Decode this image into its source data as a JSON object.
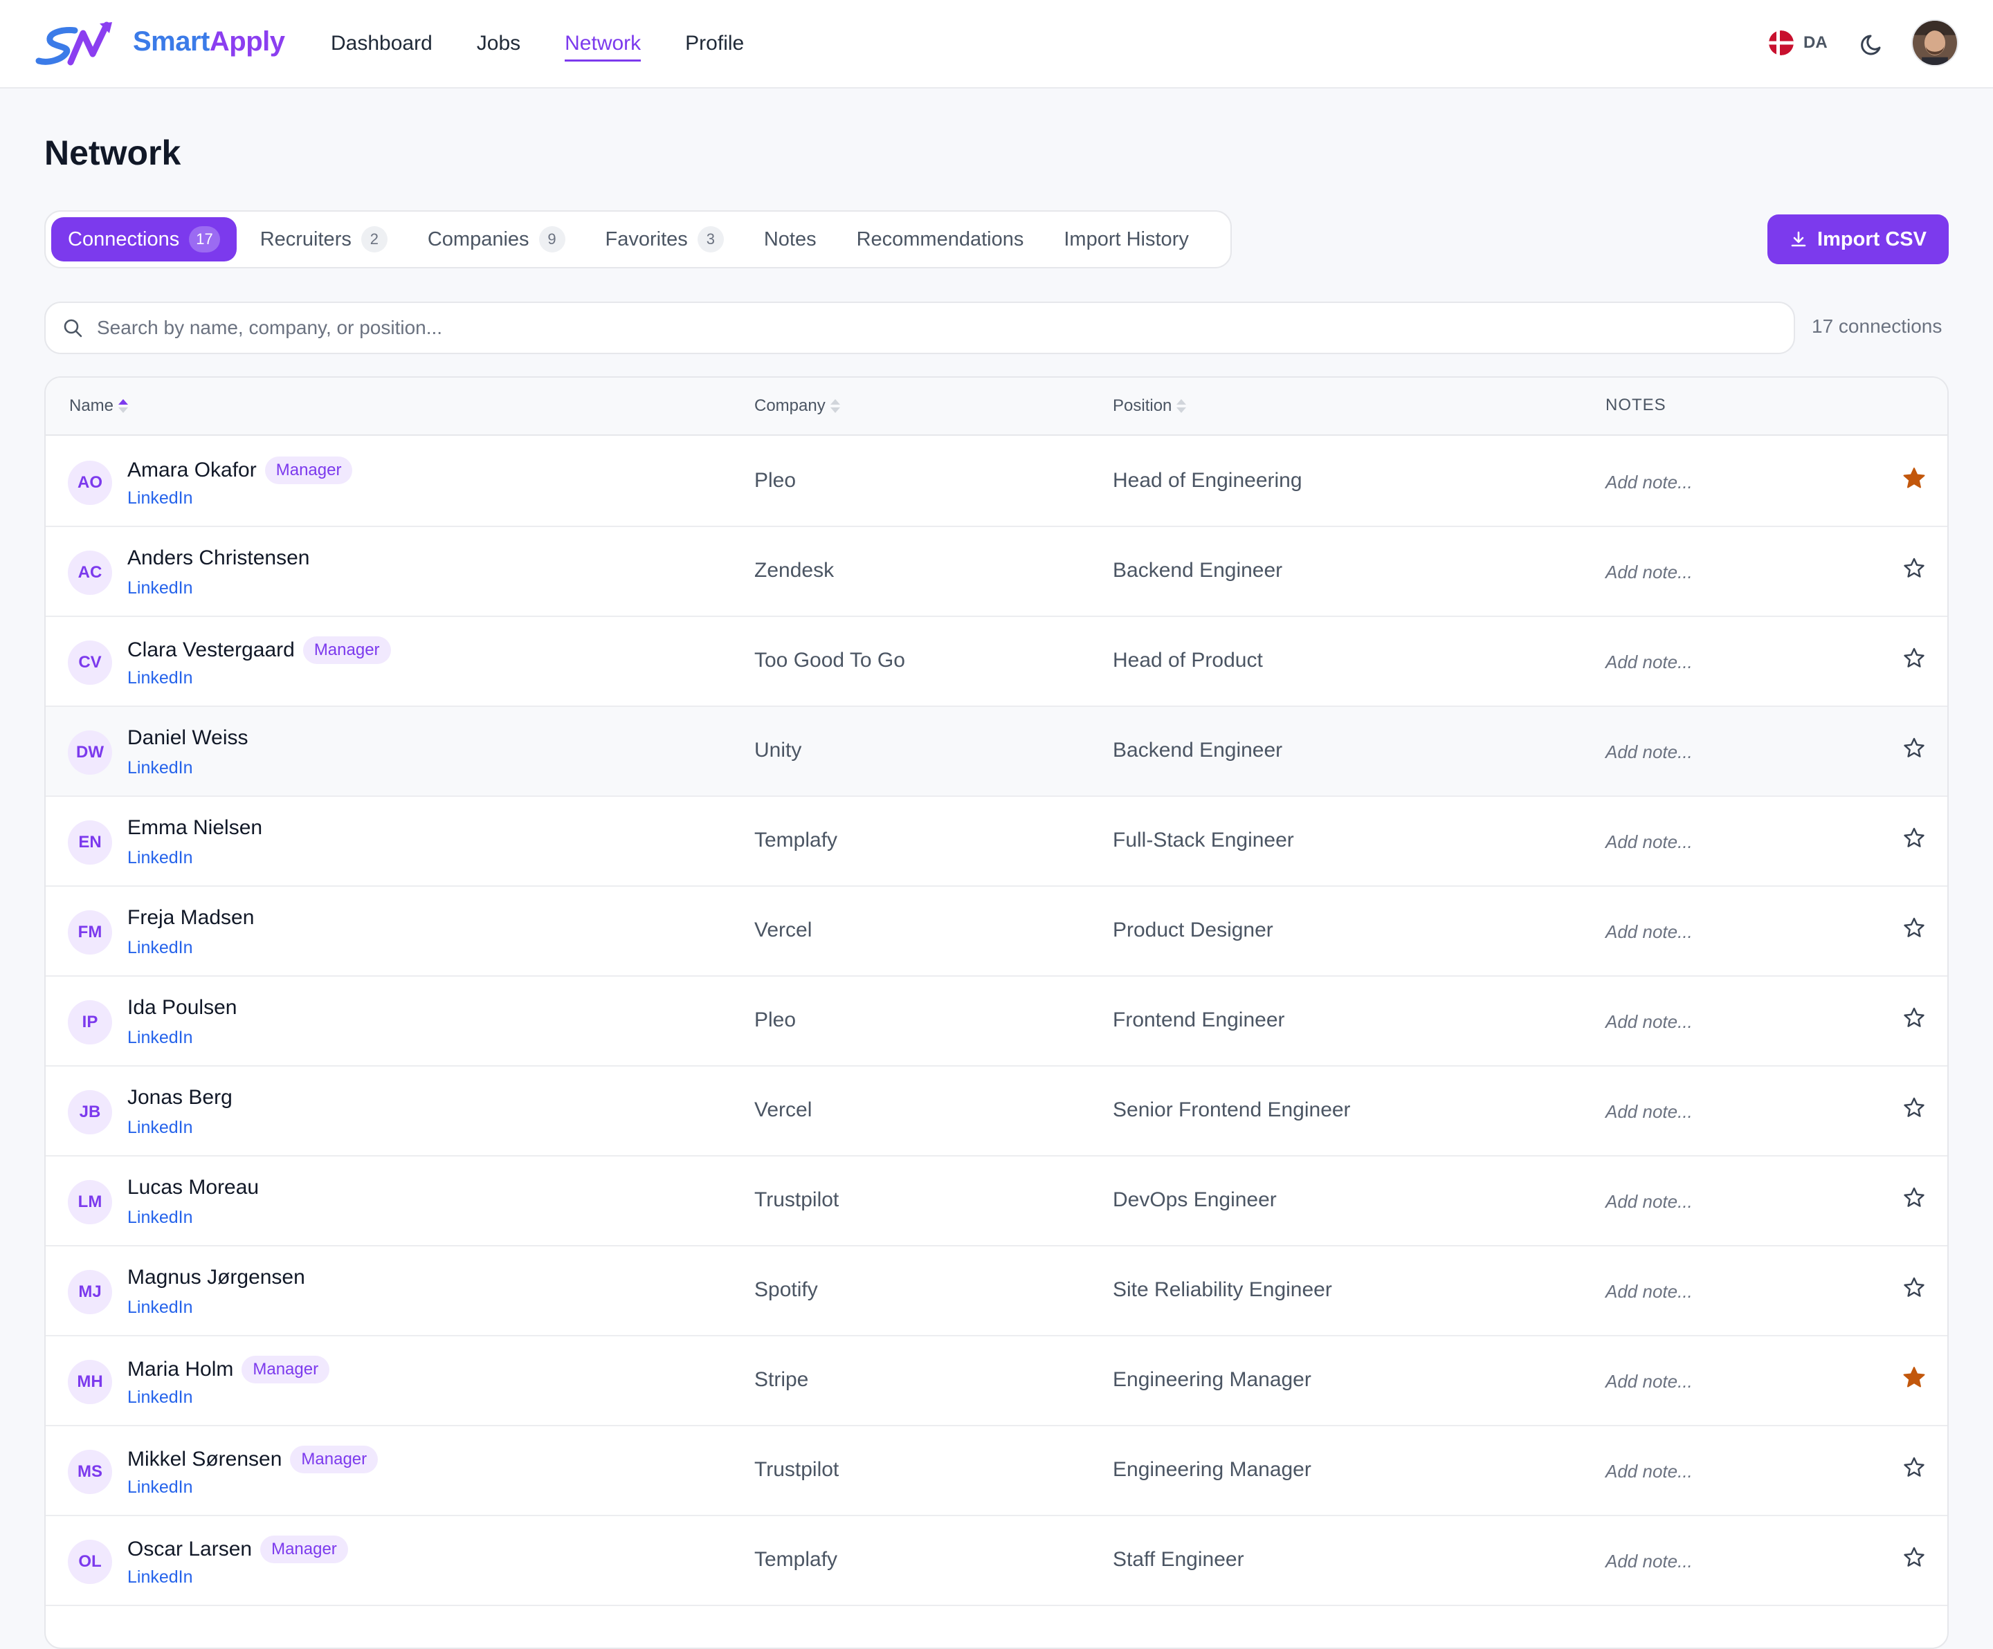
{
  "header": {
    "brand_part1": "Smart",
    "brand_part2": "Apply",
    "nav": [
      {
        "label": "Dashboard",
        "active": false
      },
      {
        "label": "Jobs",
        "active": false
      },
      {
        "label": "Network",
        "active": true
      },
      {
        "label": "Profile",
        "active": false
      }
    ],
    "language_code": "DA",
    "icons": {
      "language": "denmark-flag-icon",
      "theme": "moon-icon",
      "avatar": "user-avatar"
    }
  },
  "page": {
    "title": "Network"
  },
  "tabs": [
    {
      "label": "Connections",
      "count": "17",
      "active": true
    },
    {
      "label": "Recruiters",
      "count": "2",
      "active": false
    },
    {
      "label": "Companies",
      "count": "9",
      "active": false
    },
    {
      "label": "Favorites",
      "count": "3",
      "active": false
    },
    {
      "label": "Notes",
      "count": null,
      "active": false
    },
    {
      "label": "Recommendations",
      "count": null,
      "active": false
    },
    {
      "label": "Import History",
      "count": null,
      "active": false
    }
  ],
  "import_button": {
    "label": "Import CSV",
    "icon": "download-icon"
  },
  "search": {
    "placeholder": "Search by name, company, or position...",
    "value": "",
    "icon": "search-icon"
  },
  "connection_count": "17 connections",
  "table": {
    "columns": {
      "name": "Name",
      "company": "Company",
      "position": "Position",
      "notes": "NOTES"
    },
    "rows": [
      {
        "initials": "AO",
        "name": "Amara Okafor",
        "manager": true,
        "link": "LinkedIn",
        "company": "Pleo",
        "position": "Head of Engineering",
        "note": "Add note...",
        "favorite": true
      },
      {
        "initials": "AC",
        "name": "Anders Christensen",
        "manager": false,
        "link": "LinkedIn",
        "company": "Zendesk",
        "position": "Backend Engineer",
        "note": "Add note...",
        "favorite": false
      },
      {
        "initials": "CV",
        "name": "Clara Vestergaard",
        "manager": true,
        "link": "LinkedIn",
        "company": "Too Good To Go",
        "position": "Head of Product",
        "note": "Add note...",
        "favorite": false
      },
      {
        "initials": "DW",
        "name": "Daniel Weiss",
        "manager": false,
        "link": "LinkedIn",
        "company": "Unity",
        "position": "Backend Engineer",
        "note": "Add note...",
        "favorite": false
      },
      {
        "initials": "EN",
        "name": "Emma Nielsen",
        "manager": false,
        "link": "LinkedIn",
        "company": "Templafy",
        "position": "Full-Stack Engineer",
        "note": "Add note...",
        "favorite": false
      },
      {
        "initials": "FM",
        "name": "Freja Madsen",
        "manager": false,
        "link": "LinkedIn",
        "company": "Vercel",
        "position": "Product Designer",
        "note": "Add note...",
        "favorite": false
      },
      {
        "initials": "IP",
        "name": "Ida Poulsen",
        "manager": false,
        "link": "LinkedIn",
        "company": "Pleo",
        "position": "Frontend Engineer",
        "note": "Add note...",
        "favorite": false
      },
      {
        "initials": "JB",
        "name": "Jonas Berg",
        "manager": false,
        "link": "LinkedIn",
        "company": "Vercel",
        "position": "Senior Frontend Engineer",
        "note": "Add note...",
        "favorite": false
      },
      {
        "initials": "LM",
        "name": "Lucas Moreau",
        "manager": false,
        "link": "LinkedIn",
        "company": "Trustpilot",
        "position": "DevOps Engineer",
        "note": "Add note...",
        "favorite": false
      },
      {
        "initials": "MJ",
        "name": "Magnus Jørgensen",
        "manager": false,
        "link": "LinkedIn",
        "company": "Spotify",
        "position": "Site Reliability Engineer",
        "note": "Add note...",
        "favorite": false
      },
      {
        "initials": "MH",
        "name": "Maria Holm",
        "manager": true,
        "link": "LinkedIn",
        "company": "Stripe",
        "position": "Engineering Manager",
        "note": "Add note...",
        "favorite": true
      },
      {
        "initials": "MS",
        "name": "Mikkel Sørensen",
        "manager": true,
        "link": "LinkedIn",
        "company": "Trustpilot",
        "position": "Engineering Manager",
        "note": "Add note...",
        "favorite": false
      },
      {
        "initials": "OL",
        "name": "Oscar Larsen",
        "manager": true,
        "link": "LinkedIn",
        "company": "Templafy",
        "position": "Staff Engineer",
        "note": "Add note...",
        "favorite": false
      }
    ],
    "manager_label": "Manager"
  },
  "colors": {
    "accent": "#7c3aed",
    "brand_blue": "#3b7be8",
    "link": "#2563eb",
    "favorite_star": "#c2570c",
    "background": "#f7f8fb"
  }
}
